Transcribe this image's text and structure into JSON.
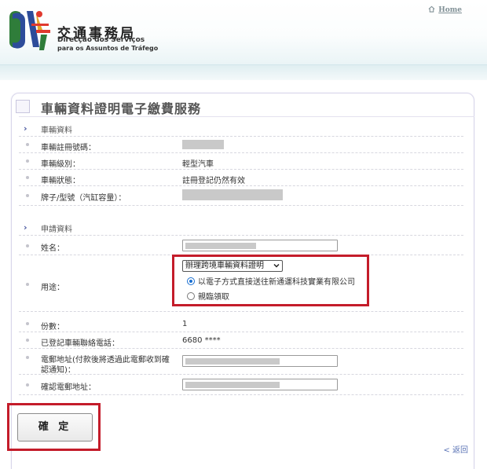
{
  "header": {
    "logo_cn": "交通事務局",
    "logo_pt_line1": "Direcção  dos  Serviços",
    "logo_pt_line2": "para os Assuntos de Tráfego",
    "home_label": "Home"
  },
  "page": {
    "title": "車輛資料證明電子繳費服務"
  },
  "vehicle_section": {
    "heading": "車輛資料",
    "rows": [
      {
        "label": "車輛註冊號碼：",
        "value": ""
      },
      {
        "label": "車輛級別：",
        "value": "輕型汽車"
      },
      {
        "label": "車輛狀態：",
        "value": "註冊登記仍然有效"
      },
      {
        "label": "牌子/型號（汽缸容量）：",
        "value": ""
      }
    ]
  },
  "application_section": {
    "heading": "申請資料",
    "name_label": "姓名：",
    "purpose_label": "用途：",
    "purpose_selected": "辦理跨境車輛資料證明",
    "delivery_options": [
      {
        "label": "以電子方式直接送往新通運科技實業有限公司",
        "checked": true
      },
      {
        "label": "親臨領取",
        "checked": false
      }
    ],
    "copies_label": "份數：",
    "copies_value": "1",
    "phone_label": "已登記車輛聯絡電話：",
    "phone_value": "6680 ****",
    "email_label_line1": "電郵地址(付款後將透過此電郵收到確",
    "email_label_line2": "認通知)：",
    "confirm_email_label": "確認電郵地址："
  },
  "actions": {
    "confirm_label": "確 定",
    "back_label": "< 返回"
  },
  "colors": {
    "highlight_red": "#c41c2a",
    "section_chevron": "#4a58a0",
    "radio_selected": "#1a6fd1"
  }
}
